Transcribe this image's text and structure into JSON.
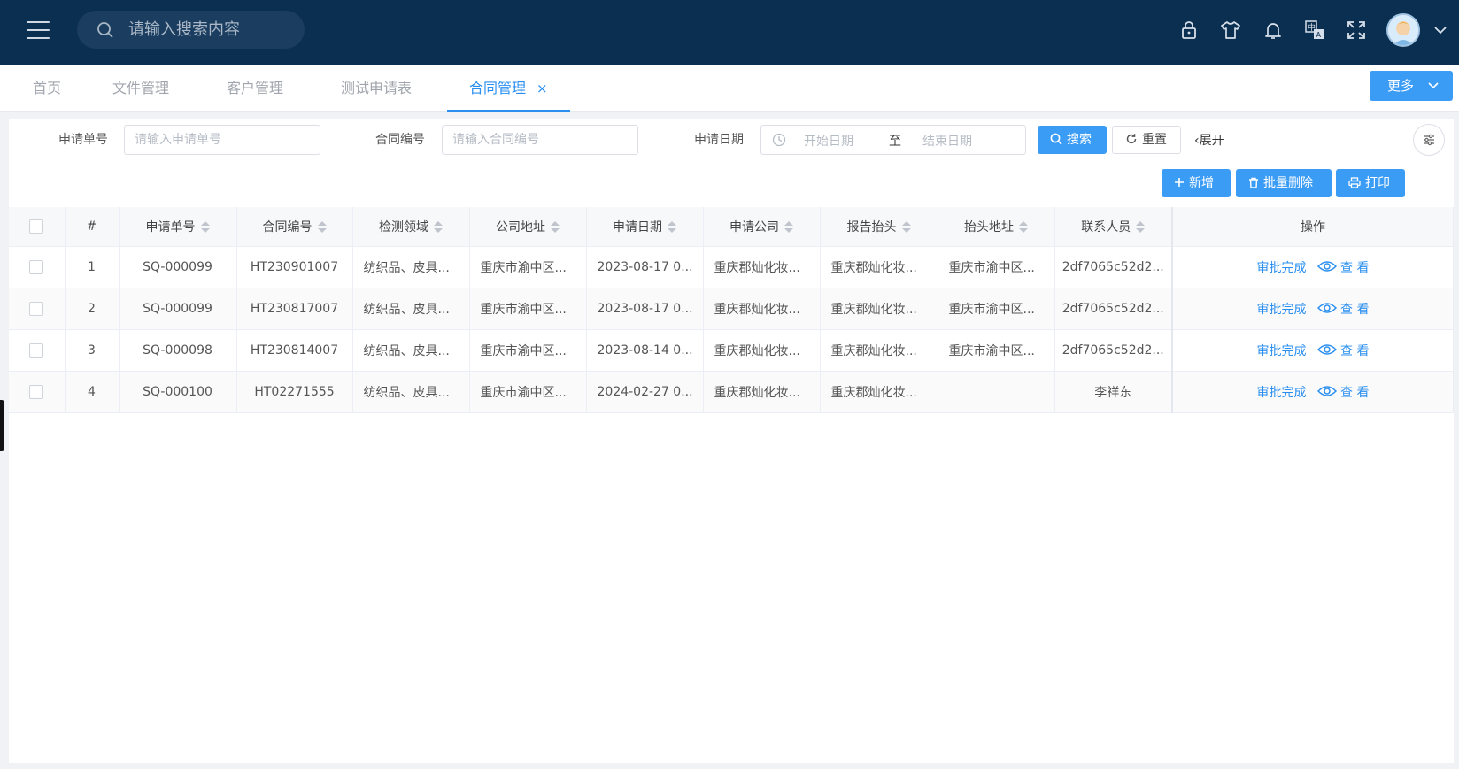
{
  "header": {
    "search_placeholder": "请输入搜索内容",
    "icons": [
      "lock-icon",
      "shirt-icon",
      "bell-icon",
      "translate-icon",
      "fullscreen-icon"
    ]
  },
  "tabs": [
    {
      "label": "首页"
    },
    {
      "label": "文件管理"
    },
    {
      "label": "客户管理"
    },
    {
      "label": "测试申请表"
    },
    {
      "label": "合同管理",
      "active": true,
      "close": "×"
    }
  ],
  "more_label": "更多",
  "filters": {
    "apply_no_label": "申请单号",
    "apply_no_placeholder": "请输入申请单号",
    "contract_no_label": "合同编号",
    "contract_no_placeholder": "请输入合同编号",
    "date_label": "申请日期",
    "date_start_placeholder": "开始日期",
    "date_separator": "至",
    "date_end_placeholder": "结束日期",
    "search_label": "搜索",
    "reset_label": "重置",
    "expand_label": "展开"
  },
  "toolbar": {
    "add_label": "新增",
    "batch_delete_label": "批量删除",
    "print_label": "打印"
  },
  "table": {
    "headers": [
      "#",
      "申请单号",
      "合同编号",
      "检测领域",
      "公司地址",
      "申请日期",
      "申请公司",
      "报告抬头",
      "抬头地址",
      "联系人员",
      "操作"
    ],
    "rows": [
      {
        "idx": "1",
        "apply_no": "SQ-000099",
        "contract_no": "HT230901007",
        "field": "纺织品、皮具...",
        "address": "重庆市渝中区...",
        "date": "2023-08-17 0...",
        "company": "重庆郡灿化妆...",
        "report_title": "重庆郡灿化妆...",
        "title_address": "重庆市渝中区...",
        "contact": "2df7065c52d2...",
        "approve": "审批完成",
        "view": "查 看"
      },
      {
        "idx": "2",
        "apply_no": "SQ-000099",
        "contract_no": "HT230817007",
        "field": "纺织品、皮具...",
        "address": "重庆市渝中区...",
        "date": "2023-08-17 0...",
        "company": "重庆郡灿化妆...",
        "report_title": "重庆郡灿化妆...",
        "title_address": "重庆市渝中区...",
        "contact": "2df7065c52d2...",
        "approve": "审批完成",
        "view": "查 看"
      },
      {
        "idx": "3",
        "apply_no": "SQ-000098",
        "contract_no": "HT230814007",
        "field": "纺织品、皮具...",
        "address": "重庆市渝中区...",
        "date": "2023-08-14 0...",
        "company": "重庆郡灿化妆...",
        "report_title": "重庆郡灿化妆...",
        "title_address": "重庆市渝中区...",
        "contact": "2df7065c52d2...",
        "approve": "审批完成",
        "view": "查 看"
      },
      {
        "idx": "4",
        "apply_no": "SQ-000100",
        "contract_no": "HT02271555",
        "field": "纺织品、皮具...",
        "address": "重庆市渝中区...",
        "date": "2024-02-27 0...",
        "company": "重庆郡灿化妆...",
        "report_title": "重庆郡灿化妆...",
        "title_address": "",
        "contact": "李祥东",
        "approve": "审批完成",
        "view": "查 看"
      }
    ]
  },
  "colors": {
    "header_bg": "#0b2f50",
    "primary": "#3b9cf5",
    "link": "#2b8ff0"
  }
}
